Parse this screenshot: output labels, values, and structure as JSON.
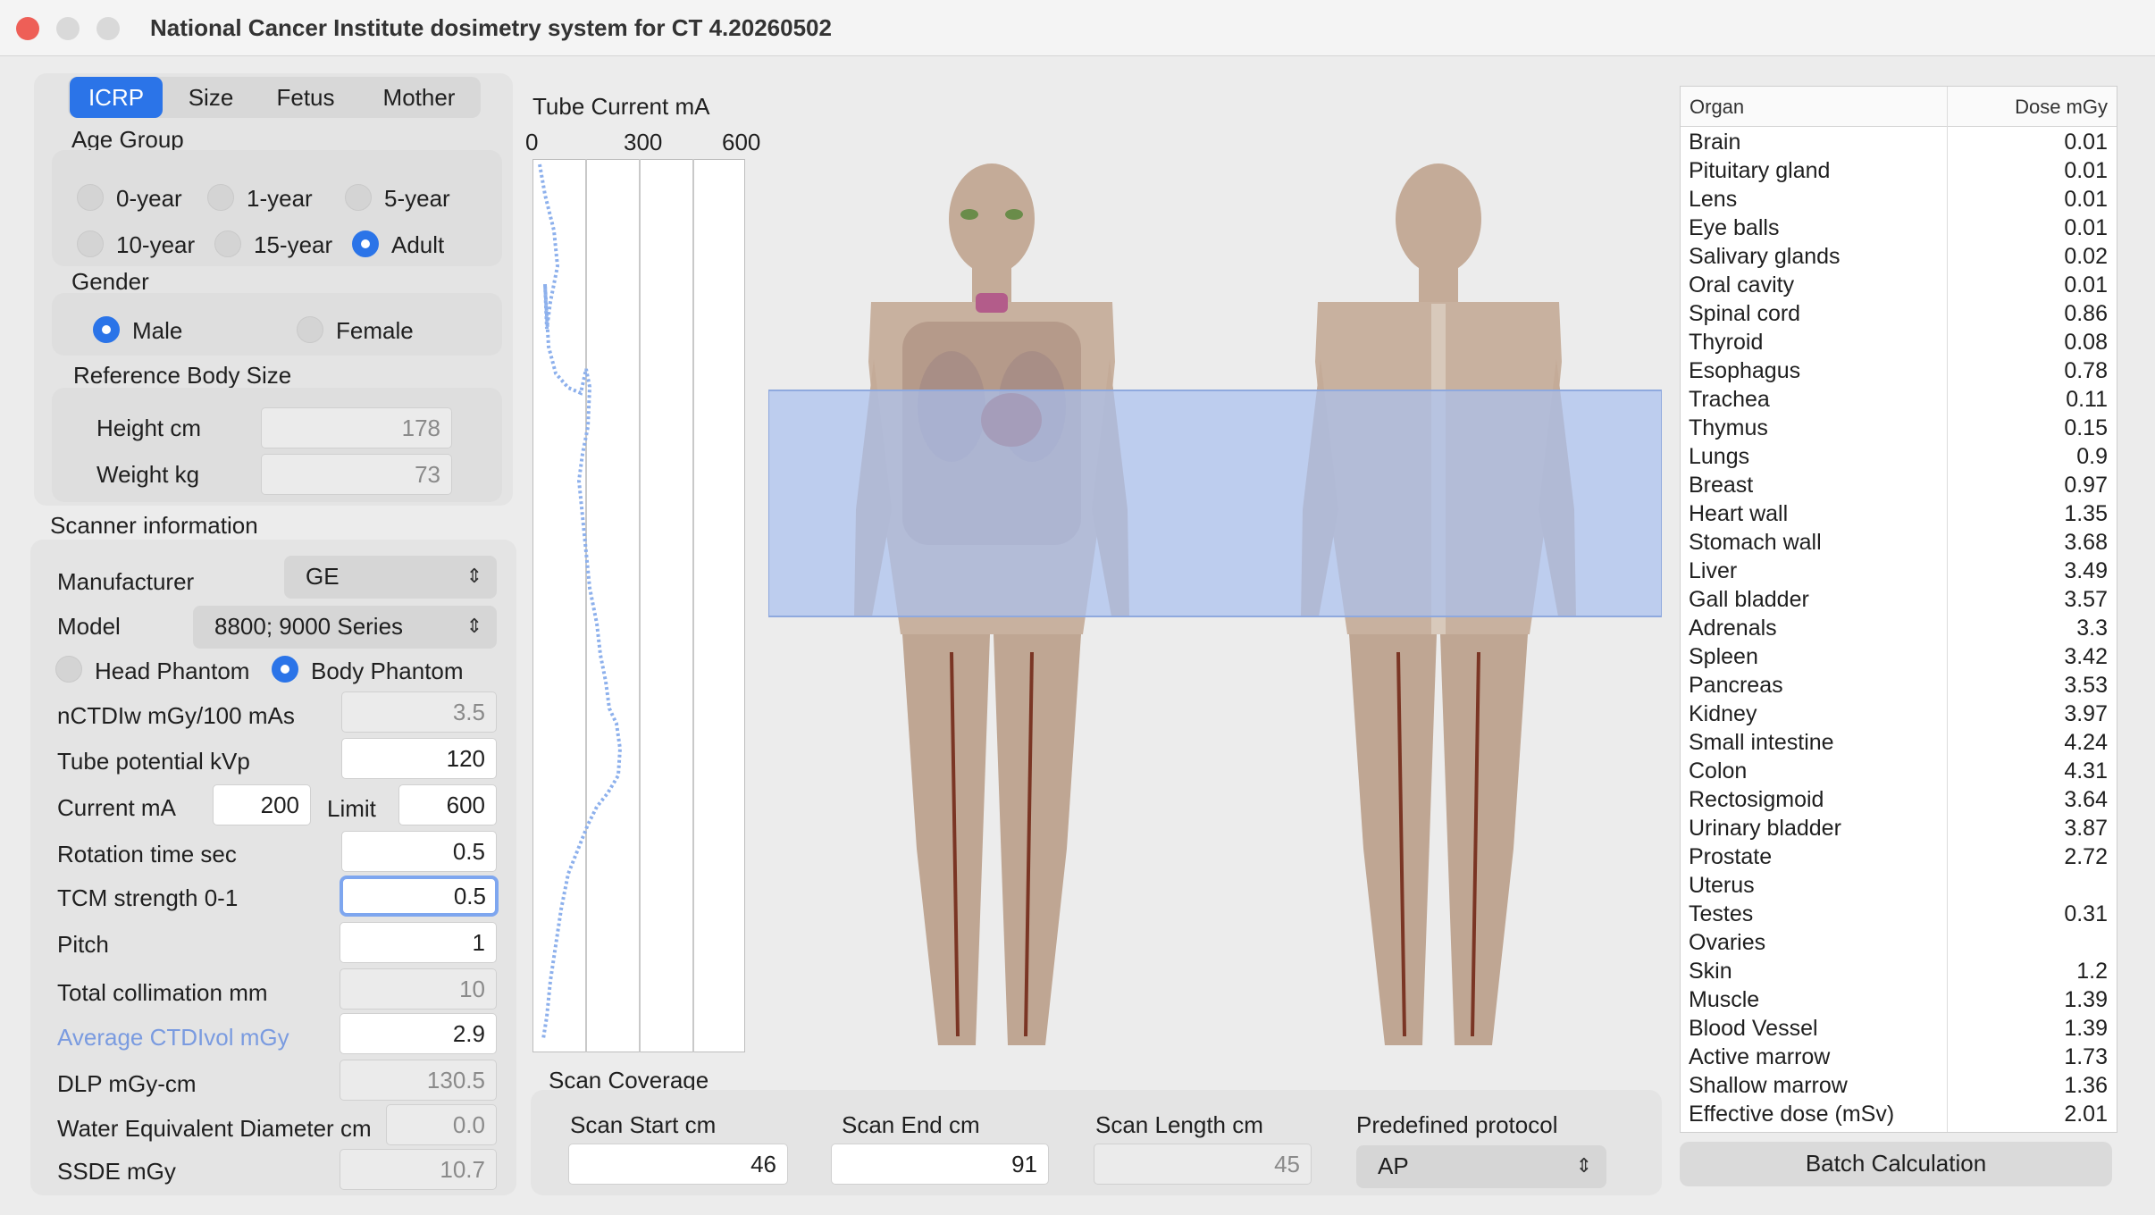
{
  "window": {
    "title": "National Cancer Institute dosimetry system for CT 4.20260502"
  },
  "tabs": [
    "ICRP",
    "Size",
    "Fetus",
    "Mother"
  ],
  "age_group": {
    "label": "Age Group",
    "options": [
      "0-year",
      "1-year",
      "5-year",
      "10-year",
      "15-year",
      "Adult"
    ],
    "selected": "Adult"
  },
  "gender": {
    "label": "Gender",
    "options": [
      "Male",
      "Female"
    ],
    "selected": "Male"
  },
  "body_size": {
    "label": "Reference Body Size",
    "height_label": "Height cm",
    "height_value": "178",
    "weight_label": "Weight kg",
    "weight_value": "73"
  },
  "scanner": {
    "section_label": "Scanner information",
    "manufacturer_label": "Manufacturer",
    "manufacturer_value": "GE",
    "model_label": "Model",
    "model_value": "8800; 9000 Series",
    "phantom_head": "Head Phantom",
    "phantom_body": "Body Phantom",
    "phantom_selected": "Body Phantom",
    "nctdi_label": "nCTDIw mGy/100 mAs",
    "nctdi_value": "3.5",
    "kvp_label": "Tube potential kVp",
    "kvp_value": "120",
    "current_label": "Current mA",
    "current_value": "200",
    "limit_label": "Limit",
    "limit_value": "600",
    "rotation_label": "Rotation time sec",
    "rotation_value": "0.5",
    "tcm_label": "TCM strength 0-1",
    "tcm_value": "0.5",
    "pitch_label": "Pitch",
    "pitch_value": "1",
    "collimation_label": "Total collimation mm",
    "collimation_value": "10",
    "ctdivol_label": "Average CTDIvol mGy",
    "ctdivol_value": "2.9",
    "dlp_label": "DLP mGy-cm",
    "dlp_value": "130.5",
    "wed_label": "Water Equivalent Diameter cm",
    "wed_value": "0.0",
    "ssde_label": "SSDE mGy",
    "ssde_value": "10.7"
  },
  "tube_current": {
    "title": "Tube Current mA",
    "ticks": [
      "0",
      "300",
      "600"
    ]
  },
  "scan_coverage": {
    "label": "Scan Coverage",
    "start_label": "Scan Start cm",
    "start_value": "46",
    "end_label": "Scan End cm",
    "end_value": "91",
    "length_label": "Scan Length cm",
    "length_value": "45",
    "protocol_label": "Predefined protocol",
    "protocol_value": "AP"
  },
  "dose_table": {
    "headers": [
      "Organ",
      "Dose mGy"
    ],
    "rows": [
      [
        "Brain",
        "0.01"
      ],
      [
        "Pituitary gland",
        "0.01"
      ],
      [
        "Lens",
        "0.01"
      ],
      [
        "Eye balls",
        "0.01"
      ],
      [
        "Salivary glands",
        "0.02"
      ],
      [
        "Oral cavity",
        "0.01"
      ],
      [
        "Spinal cord",
        "0.86"
      ],
      [
        "Thyroid",
        "0.08"
      ],
      [
        "Esophagus",
        "0.78"
      ],
      [
        "Trachea",
        "0.11"
      ],
      [
        "Thymus",
        "0.15"
      ],
      [
        "Lungs",
        "0.9"
      ],
      [
        "Breast",
        "0.97"
      ],
      [
        "Heart wall",
        "1.35"
      ],
      [
        "Stomach wall",
        "3.68"
      ],
      [
        "Liver",
        "3.49"
      ],
      [
        "Gall bladder",
        "3.57"
      ],
      [
        "Adrenals",
        "3.3"
      ],
      [
        "Spleen",
        "3.42"
      ],
      [
        "Pancreas",
        "3.53"
      ],
      [
        "Kidney",
        "3.97"
      ],
      [
        "Small intestine",
        "4.24"
      ],
      [
        "Colon",
        "4.31"
      ],
      [
        "Rectosigmoid",
        "3.64"
      ],
      [
        "Urinary bladder",
        "3.87"
      ],
      [
        "Prostate",
        "2.72"
      ],
      [
        "Uterus",
        ""
      ],
      [
        "Testes",
        "0.31"
      ],
      [
        "Ovaries",
        ""
      ],
      [
        "Skin",
        "1.2"
      ],
      [
        "Muscle",
        "1.39"
      ],
      [
        "Blood Vessel",
        "1.39"
      ],
      [
        "Active marrow",
        "1.73"
      ],
      [
        "Shallow marrow",
        "1.36"
      ],
      [
        "Effective dose (mSv)",
        "2.01"
      ]
    ]
  },
  "batch_button": "Batch Calculation",
  "colors": {
    "accent": "#2b74e8",
    "scan_region": "#a9c1f0",
    "curve": "#8db0ec",
    "ctdivol_label": "#7a9be0"
  }
}
